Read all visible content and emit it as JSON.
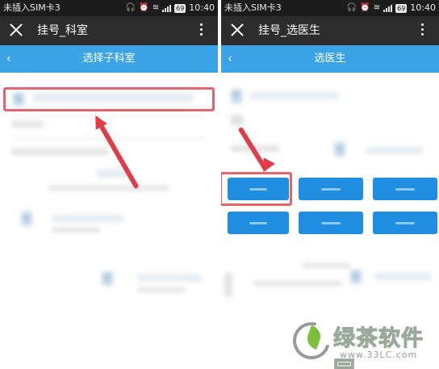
{
  "colors": {
    "status_bar": "#1c1c1c",
    "title_bar": "#2d2d2d",
    "nav_bar": "#3ba3e6",
    "doctor_button": "#1f8ee0",
    "highlight": "#e9636c",
    "arrow": "#e03d48"
  },
  "left_screen": {
    "status": {
      "carrier": "未插入SIM卡3",
      "time": "10:40",
      "battery": "69"
    },
    "titlebar": {
      "title": "挂号_科室"
    },
    "navbar": {
      "back_glyph": "‹",
      "title": "选择子科室"
    }
  },
  "right_screen": {
    "status": {
      "carrier": "未插入SIM卡3",
      "time": "10:40",
      "battery": "69"
    },
    "titlebar": {
      "title": "挂号_选医生"
    },
    "navbar": {
      "back_glyph": "‹",
      "title": "选医生"
    }
  },
  "watermark": {
    "name": "绿茶软件园",
    "url": "www.33LC.com"
  }
}
